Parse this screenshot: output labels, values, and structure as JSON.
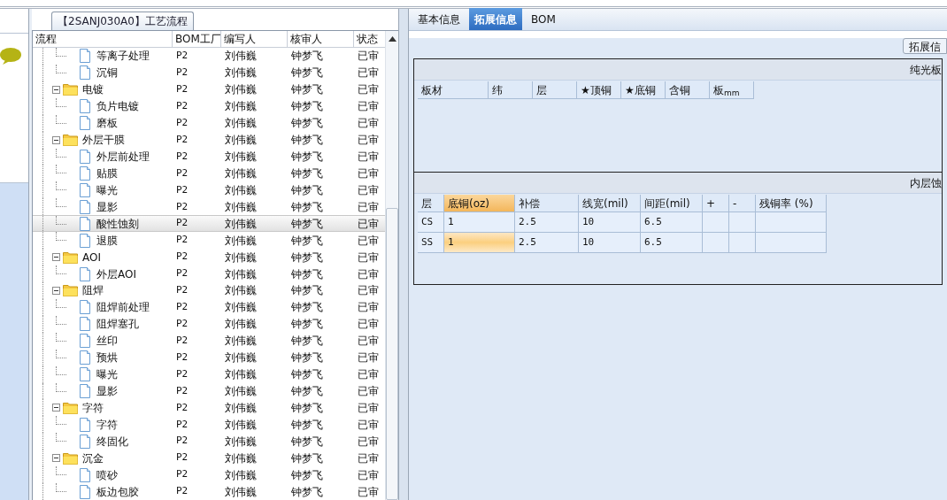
{
  "process_panel": {
    "title": "【2SANJ030A0】工艺流程",
    "columns": [
      "流程",
      "BOM工厂",
      "编写人",
      "核审人",
      "状态"
    ],
    "tree": {
      "continued_children": [
        {
          "kind": "file",
          "label": "等离子处理",
          "bom": "P2",
          "writer": "刘伟巍",
          "reviewer": "钟梦飞",
          "status": "已审",
          "selected": false
        },
        {
          "kind": "file",
          "label": "沉铜",
          "bom": "P2",
          "writer": "刘伟巍",
          "reviewer": "钟梦飞",
          "status": "已审",
          "selected": false
        }
      ],
      "nodes": [
        {
          "kind": "folder",
          "label": "电镀",
          "bom": "P2",
          "writer": "刘伟巍",
          "reviewer": "钟梦飞",
          "status": "已审",
          "selected": false,
          "expanded": true,
          "children": [
            {
              "kind": "file",
              "label": "负片电镀",
              "bom": "P2",
              "writer": "刘伟巍",
              "reviewer": "钟梦飞",
              "status": "已审",
              "selected": false
            },
            {
              "kind": "file",
              "label": "磨板",
              "bom": "P2",
              "writer": "刘伟巍",
              "reviewer": "钟梦飞",
              "status": "已审",
              "selected": false
            }
          ]
        },
        {
          "kind": "folder",
          "label": "外层干膜",
          "bom": "P2",
          "writer": "刘伟巍",
          "reviewer": "钟梦飞",
          "status": "已审",
          "selected": false,
          "expanded": true,
          "children": [
            {
              "kind": "file",
              "label": "外层前处理",
              "bom": "P2",
              "writer": "刘伟巍",
              "reviewer": "钟梦飞",
              "status": "已审",
              "selected": false
            },
            {
              "kind": "file",
              "label": "贴膜",
              "bom": "P2",
              "writer": "刘伟巍",
              "reviewer": "钟梦飞",
              "status": "已审",
              "selected": false
            },
            {
              "kind": "file",
              "label": "曝光",
              "bom": "P2",
              "writer": "刘伟巍",
              "reviewer": "钟梦飞",
              "status": "已审",
              "selected": false
            },
            {
              "kind": "file",
              "label": "显影",
              "bom": "P2",
              "writer": "刘伟巍",
              "reviewer": "钟梦飞",
              "status": "已审",
              "selected": false
            },
            {
              "kind": "file",
              "label": "酸性蚀刻",
              "bom": "P2",
              "writer": "刘伟巍",
              "reviewer": "钟梦飞",
              "status": "已审",
              "selected": true
            },
            {
              "kind": "file",
              "label": "退膜",
              "bom": "P2",
              "writer": "刘伟巍",
              "reviewer": "钟梦飞",
              "status": "已审",
              "selected": false
            }
          ]
        },
        {
          "kind": "folder",
          "label": "AOI",
          "bom": "P2",
          "writer": "刘伟巍",
          "reviewer": "钟梦飞",
          "status": "已审",
          "selected": false,
          "expanded": true,
          "children": [
            {
              "kind": "file",
              "label": "外层AOI",
              "bom": "P2",
              "writer": "刘伟巍",
              "reviewer": "钟梦飞",
              "status": "已审",
              "selected": false
            }
          ]
        },
        {
          "kind": "folder",
          "label": "阻焊",
          "bom": "P2",
          "writer": "刘伟巍",
          "reviewer": "钟梦飞",
          "status": "已审",
          "selected": false,
          "expanded": true,
          "children": [
            {
              "kind": "file",
              "label": "阻焊前处理",
              "bom": "P2",
              "writer": "刘伟巍",
              "reviewer": "钟梦飞",
              "status": "已审",
              "selected": false
            },
            {
              "kind": "file",
              "label": "阻焊塞孔",
              "bom": "P2",
              "writer": "刘伟巍",
              "reviewer": "钟梦飞",
              "status": "已审",
              "selected": false
            },
            {
              "kind": "file",
              "label": "丝印",
              "bom": "P2",
              "writer": "刘伟巍",
              "reviewer": "钟梦飞",
              "status": "已审",
              "selected": false
            },
            {
              "kind": "file",
              "label": "预烘",
              "bom": "P2",
              "writer": "刘伟巍",
              "reviewer": "钟梦飞",
              "status": "已审",
              "selected": false
            },
            {
              "kind": "file",
              "label": "曝光",
              "bom": "P2",
              "writer": "刘伟巍",
              "reviewer": "钟梦飞",
              "status": "已审",
              "selected": false
            },
            {
              "kind": "file",
              "label": "显影",
              "bom": "P2",
              "writer": "刘伟巍",
              "reviewer": "钟梦飞",
              "status": "已审",
              "selected": false
            }
          ]
        },
        {
          "kind": "folder",
          "label": "字符",
          "bom": "P2",
          "writer": "刘伟巍",
          "reviewer": "钟梦飞",
          "status": "已审",
          "selected": false,
          "expanded": true,
          "children": [
            {
              "kind": "file",
              "label": "字符",
              "bom": "P2",
              "writer": "刘伟巍",
              "reviewer": "钟梦飞",
              "status": "已审",
              "selected": false
            },
            {
              "kind": "file",
              "label": "终固化",
              "bom": "P2",
              "writer": "刘伟巍",
              "reviewer": "钟梦飞",
              "status": "已审",
              "selected": false
            }
          ]
        },
        {
          "kind": "folder",
          "label": "沉金",
          "bom": "P2",
          "writer": "刘伟巍",
          "reviewer": "钟梦飞",
          "status": "已审",
          "selected": false,
          "expanded": true,
          "children": [
            {
              "kind": "file",
              "label": "喷砂",
              "bom": "P2",
              "writer": "刘伟巍",
              "reviewer": "钟梦飞",
              "status": "已审",
              "selected": false
            },
            {
              "kind": "file",
              "label": "板边包胶",
              "bom": "P2",
              "writer": "刘伟巍",
              "reviewer": "钟梦飞",
              "status": "已审",
              "selected": false
            }
          ]
        }
      ]
    }
  },
  "detail_panel": {
    "tabs": [
      {
        "label": "基本信息",
        "selected": false
      },
      {
        "label": "拓展信息",
        "selected": true
      },
      {
        "label": "BOM",
        "selected": false
      }
    ],
    "group_tab": "拓展信",
    "sections": [
      {
        "title": "纯光板",
        "columns": [
          {
            "label": "板材",
            "selected": false
          },
          {
            "label": "纬",
            "selected": false
          },
          {
            "label": "层",
            "selected": false
          },
          {
            "label": "★顶铜",
            "selected": false
          },
          {
            "label": "★底铜",
            "selected": false
          },
          {
            "label": "含铜",
            "selected": false
          },
          {
            "label": "板$_{mm}$",
            "selected": false
          }
        ]
      },
      {
        "title": "内层蚀",
        "columns": [
          {
            "label": "层",
            "selected": false
          },
          {
            "label": "底铜(oz)",
            "selected": true
          },
          {
            "label": "补偿",
            "selected": false
          },
          {
            "label": "线宽(mil)",
            "selected": false
          },
          {
            "label": "间距(mil)",
            "selected": false
          },
          {
            "label": "+",
            "selected": false
          },
          {
            "label": "-",
            "selected": false
          },
          {
            "label": "残铜率 (%)",
            "selected": false
          }
        ],
        "rows": [
          [
            {
              "text": "CS",
              "selected": false
            },
            {
              "text": "1",
              "selected": false
            },
            {
              "text": "2.5",
              "selected": false
            },
            {
              "text": "10",
              "selected": false
            },
            {
              "text": "6.5",
              "selected": false
            },
            {
              "selected": false
            },
            {
              "selected": false
            },
            {
              "selected": false
            }
          ],
          [
            {
              "text": "SS",
              "selected": false
            },
            {
              "text": "1",
              "selected": true
            },
            {
              "text": "2.5",
              "selected": false
            },
            {
              "text": "10",
              "selected": false
            },
            {
              "text": "6.5",
              "selected": false
            },
            {
              "selected": false
            },
            {
              "selected": false
            },
            {
              "selected": false
            }
          ]
        ]
      }
    ]
  }
}
